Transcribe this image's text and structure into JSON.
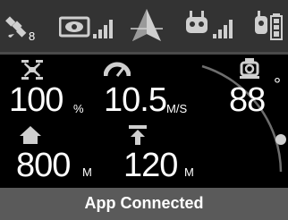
{
  "status_bar": {
    "satellite_icon": "satellite-icon",
    "satellite_count": "8",
    "camera_link_icon": "camera-signal-icon",
    "north_arrow_icon": "north-arrow-icon",
    "remote_signal_icon": "remote-controller-signal-icon",
    "drone_battery_icon": "drone-battery-icon",
    "signal_bars": {
      "camera_link": 4,
      "remote_link": 4,
      "drone_battery": 4
    }
  },
  "telemetry": {
    "battery": {
      "icon": "drone-icon",
      "value": "100",
      "unit": "%"
    },
    "speed": {
      "icon": "gauge-icon",
      "value": "10.5",
      "unit": "M/S"
    },
    "home_distance": {
      "icon": "home-icon",
      "value": "800",
      "unit": "M"
    },
    "altitude": {
      "icon": "altitude-icon",
      "value": "120",
      "unit": "M"
    },
    "gimbal": {
      "icon": "gimbal-camera-icon",
      "value": "88",
      "unit": "°"
    }
  },
  "status": {
    "message": "App Connected"
  },
  "colors": {
    "top_bar": "#333333",
    "background": "#000000",
    "footer": "#5a5a5a",
    "icon": "#cfcfcf",
    "text": "#ffffff"
  }
}
